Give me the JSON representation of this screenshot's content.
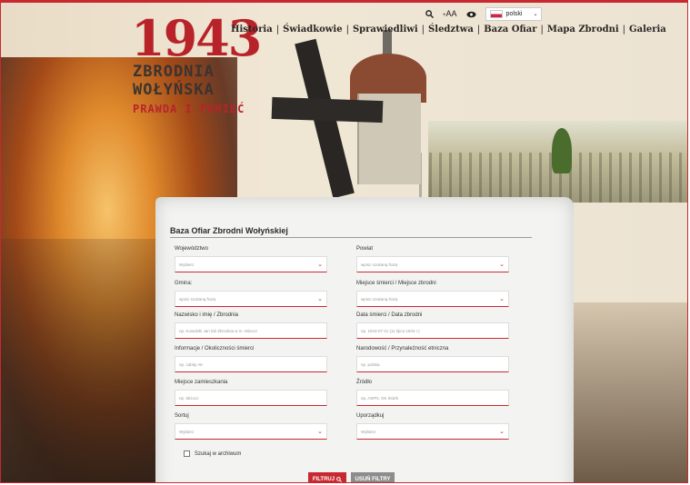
{
  "logo": {
    "year": "1943",
    "line1": "ZBRODNIA",
    "line2": "WOŁYŃSKA",
    "tagline": "PRAWDA I PAMIĘĆ"
  },
  "topbar": {
    "font_size_small": "+",
    "font_size_label": "AA",
    "language": "polski"
  },
  "nav": [
    "Historia",
    "Świadkowie",
    "Sprawiedliwi",
    "Śledztwa",
    "Baza Ofiar",
    "Mapa Zbrodni",
    "Galeria"
  ],
  "form": {
    "title": "Baza Ofiar Zbrodni Wołyńskiej",
    "fields": [
      {
        "label": "Województwo",
        "placeholder": "Wybierz",
        "type": "select"
      },
      {
        "label": "Powiat",
        "placeholder": "wpisz szukaną frazę",
        "type": "select"
      },
      {
        "label": "Gmina:",
        "placeholder": "wpisz szukaną frazę",
        "type": "select"
      },
      {
        "label": "Miejsce śmierci / Miejsce zbrodni",
        "placeholder": "wpisz szukaną frazę",
        "type": "select"
      },
      {
        "label": "Nazwisko i imię / Zbrodnia",
        "placeholder": "np. Kowalski Jan lub Zbrodnia w m. Mizocz",
        "type": "text"
      },
      {
        "label": "Data śmierci / Data zbrodni",
        "placeholder": "np. 1943-07-11 (11 lipca 1943 r.)",
        "type": "text"
      },
      {
        "label": "Informacje / Okoliczności śmierci",
        "placeholder": "np. zabity AK",
        "type": "text"
      },
      {
        "label": "Narodowość / Przynależność etniczna",
        "placeholder": "np. polska",
        "type": "text"
      },
      {
        "label": "Miejsce zamieszkania",
        "placeholder": "np. Mizocz",
        "type": "text"
      },
      {
        "label": "Źródło",
        "placeholder": "np. ASPN, OK 932/6",
        "type": "text"
      },
      {
        "label": "Sortuj",
        "placeholder": "Wybierz",
        "type": "select"
      },
      {
        "label": "Uporządkuj",
        "placeholder": "Wybierz",
        "type": "select"
      }
    ],
    "archive_checkbox": "Szukaj w archiwum",
    "filter_button": "FILTRUJ",
    "clear_button": "USUŃ FILTRY"
  },
  "colors": {
    "accent": "#c8282f",
    "secondary_button": "#8c8c8c"
  }
}
